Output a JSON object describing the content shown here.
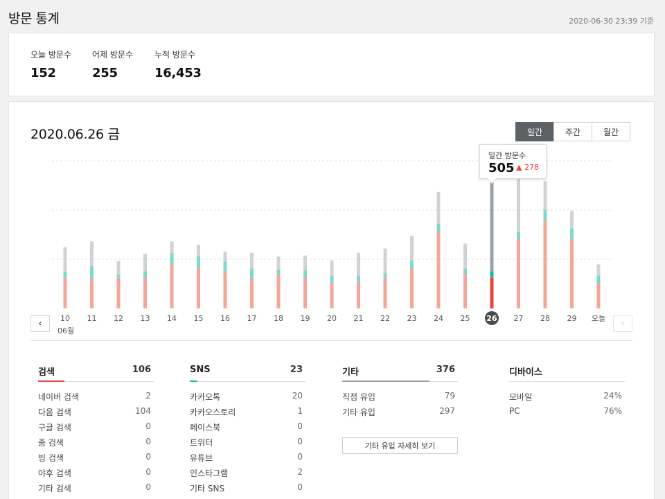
{
  "header": {
    "title": "방문 통계",
    "timestamp": "2020-06-30 23:39 기준"
  },
  "summary": [
    {
      "label": "오늘 방문수",
      "value": "152"
    },
    {
      "label": "어제 방문수",
      "value": "255"
    },
    {
      "label": "누적 방문수",
      "value": "16,453"
    }
  ],
  "main": {
    "date_title": "2020.06.26 금",
    "period_tabs": [
      {
        "label": "일간",
        "active": true
      },
      {
        "label": "주간",
        "active": false
      },
      {
        "label": "월간",
        "active": false
      }
    ],
    "prev_icon": "chevron-left-icon",
    "next_icon": "chevron-right-icon",
    "prev_glyph": "‹",
    "next_glyph": "›",
    "month_label": "06월"
  },
  "tooltip": {
    "label": "일간 방문수",
    "value": "505",
    "delta": "▲ 278"
  },
  "colors": {
    "search": "#f5a59a",
    "search_selected": "#e8463b",
    "sns": "#7fd8cc",
    "sns_selected": "#1fb8a4",
    "other": "#cfd3d6",
    "other_selected": "#98a2a8",
    "search_accent": "#e8463b",
    "sns_accent": "#1fb8a4",
    "other_accent": "#98a2a8"
  },
  "chart_data": {
    "type": "bar",
    "stacked": true,
    "selected": "26",
    "categories": [
      "10",
      "11",
      "12",
      "13",
      "14",
      "15",
      "16",
      "17",
      "18",
      "19",
      "20",
      "21",
      "22",
      "23",
      "24",
      "25",
      "26",
      "27",
      "28",
      "29",
      "오늘"
    ],
    "series": [
      {
        "name": "검색",
        "values": [
          106,
          106,
          106,
          106,
          152,
          140,
          125,
          106,
          118,
          106,
          86,
          92,
          106,
          137,
          265,
          118,
          106,
          240,
          305,
          240,
          86
        ]
      },
      {
        "name": "SNS",
        "values": [
          20,
          40,
          12,
          23,
          40,
          40,
          37,
          32,
          15,
          25,
          28,
          20,
          15,
          28,
          28,
          20,
          23,
          24,
          37,
          37,
          28
        ]
      },
      {
        "name": "기타",
        "values": [
          86,
          86,
          46,
          60,
          40,
          40,
          34,
          54,
          46,
          52,
          52,
          80,
          86,
          86,
          110,
          86,
          376,
          230,
          98,
          60,
          38
        ]
      }
    ],
    "ylim": [
      0,
      580
    ],
    "grid": true
  },
  "sections": [
    {
      "key": "search",
      "title": "검색",
      "total": "106",
      "rows": [
        {
          "label": "네이버 검색",
          "value": "2"
        },
        {
          "label": "다음 검색",
          "value": "104"
        },
        {
          "label": "구글 검색",
          "value": "0"
        },
        {
          "label": "줌 검색",
          "value": "0"
        },
        {
          "label": "빙 검색",
          "value": "0"
        },
        {
          "label": "야후 검색",
          "value": "0"
        },
        {
          "label": "기타 검색",
          "value": "0"
        }
      ]
    },
    {
      "key": "sns",
      "title": "SNS",
      "total": "23",
      "rows": [
        {
          "label": "카카오톡",
          "value": "20"
        },
        {
          "label": "카카오스토리",
          "value": "1"
        },
        {
          "label": "페이스북",
          "value": "0"
        },
        {
          "label": "트위터",
          "value": "0"
        },
        {
          "label": "유튜브",
          "value": "0"
        },
        {
          "label": "인스타그램",
          "value": "2"
        },
        {
          "label": "기타 SNS",
          "value": "0"
        }
      ]
    },
    {
      "key": "other",
      "title": "기타",
      "total": "376",
      "rows": [
        {
          "label": "직접 유입",
          "value": "79"
        },
        {
          "label": "기타 유입",
          "value": "297"
        }
      ],
      "button": "기타 유입 자세히 보기"
    },
    {
      "key": "device",
      "title": "디바이스",
      "total": "",
      "rows": [
        {
          "label": "모바일",
          "value": "24%"
        },
        {
          "label": "PC",
          "value": "76%"
        }
      ]
    }
  ]
}
